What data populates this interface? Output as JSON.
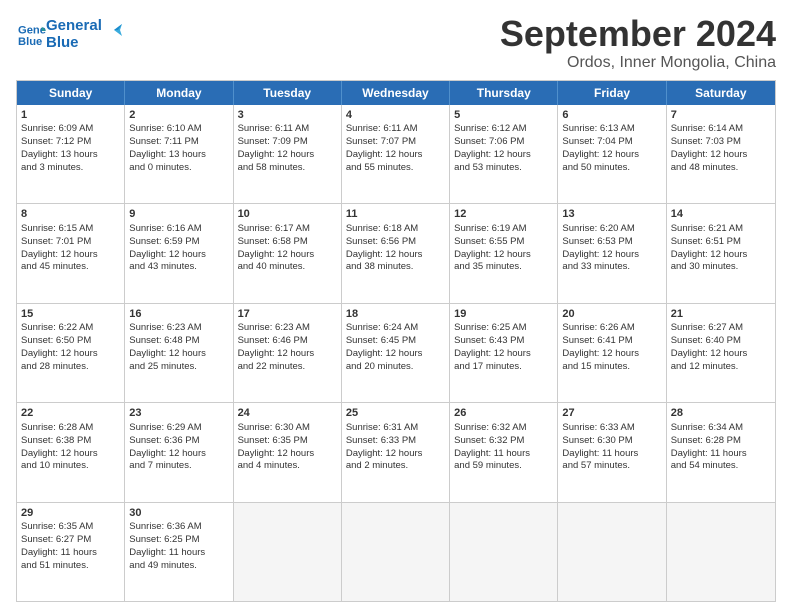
{
  "header": {
    "logo_line1": "General",
    "logo_line2": "Blue",
    "month": "September 2024",
    "location": "Ordos, Inner Mongolia, China"
  },
  "days_of_week": [
    "Sunday",
    "Monday",
    "Tuesday",
    "Wednesday",
    "Thursday",
    "Friday",
    "Saturday"
  ],
  "rows": [
    [
      {
        "day": "1",
        "lines": [
          "Sunrise: 6:09 AM",
          "Sunset: 7:12 PM",
          "Daylight: 13 hours",
          "and 3 minutes."
        ]
      },
      {
        "day": "2",
        "lines": [
          "Sunrise: 6:10 AM",
          "Sunset: 7:11 PM",
          "Daylight: 13 hours",
          "and 0 minutes."
        ]
      },
      {
        "day": "3",
        "lines": [
          "Sunrise: 6:11 AM",
          "Sunset: 7:09 PM",
          "Daylight: 12 hours",
          "and 58 minutes."
        ]
      },
      {
        "day": "4",
        "lines": [
          "Sunrise: 6:11 AM",
          "Sunset: 7:07 PM",
          "Daylight: 12 hours",
          "and 55 minutes."
        ]
      },
      {
        "day": "5",
        "lines": [
          "Sunrise: 6:12 AM",
          "Sunset: 7:06 PM",
          "Daylight: 12 hours",
          "and 53 minutes."
        ]
      },
      {
        "day": "6",
        "lines": [
          "Sunrise: 6:13 AM",
          "Sunset: 7:04 PM",
          "Daylight: 12 hours",
          "and 50 minutes."
        ]
      },
      {
        "day": "7",
        "lines": [
          "Sunrise: 6:14 AM",
          "Sunset: 7:03 PM",
          "Daylight: 12 hours",
          "and 48 minutes."
        ]
      }
    ],
    [
      {
        "day": "8",
        "lines": [
          "Sunrise: 6:15 AM",
          "Sunset: 7:01 PM",
          "Daylight: 12 hours",
          "and 45 minutes."
        ]
      },
      {
        "day": "9",
        "lines": [
          "Sunrise: 6:16 AM",
          "Sunset: 6:59 PM",
          "Daylight: 12 hours",
          "and 43 minutes."
        ]
      },
      {
        "day": "10",
        "lines": [
          "Sunrise: 6:17 AM",
          "Sunset: 6:58 PM",
          "Daylight: 12 hours",
          "and 40 minutes."
        ]
      },
      {
        "day": "11",
        "lines": [
          "Sunrise: 6:18 AM",
          "Sunset: 6:56 PM",
          "Daylight: 12 hours",
          "and 38 minutes."
        ]
      },
      {
        "day": "12",
        "lines": [
          "Sunrise: 6:19 AM",
          "Sunset: 6:55 PM",
          "Daylight: 12 hours",
          "and 35 minutes."
        ]
      },
      {
        "day": "13",
        "lines": [
          "Sunrise: 6:20 AM",
          "Sunset: 6:53 PM",
          "Daylight: 12 hours",
          "and 33 minutes."
        ]
      },
      {
        "day": "14",
        "lines": [
          "Sunrise: 6:21 AM",
          "Sunset: 6:51 PM",
          "Daylight: 12 hours",
          "and 30 minutes."
        ]
      }
    ],
    [
      {
        "day": "15",
        "lines": [
          "Sunrise: 6:22 AM",
          "Sunset: 6:50 PM",
          "Daylight: 12 hours",
          "and 28 minutes."
        ]
      },
      {
        "day": "16",
        "lines": [
          "Sunrise: 6:23 AM",
          "Sunset: 6:48 PM",
          "Daylight: 12 hours",
          "and 25 minutes."
        ]
      },
      {
        "day": "17",
        "lines": [
          "Sunrise: 6:23 AM",
          "Sunset: 6:46 PM",
          "Daylight: 12 hours",
          "and 22 minutes."
        ]
      },
      {
        "day": "18",
        "lines": [
          "Sunrise: 6:24 AM",
          "Sunset: 6:45 PM",
          "Daylight: 12 hours",
          "and 20 minutes."
        ]
      },
      {
        "day": "19",
        "lines": [
          "Sunrise: 6:25 AM",
          "Sunset: 6:43 PM",
          "Daylight: 12 hours",
          "and 17 minutes."
        ]
      },
      {
        "day": "20",
        "lines": [
          "Sunrise: 6:26 AM",
          "Sunset: 6:41 PM",
          "Daylight: 12 hours",
          "and 15 minutes."
        ]
      },
      {
        "day": "21",
        "lines": [
          "Sunrise: 6:27 AM",
          "Sunset: 6:40 PM",
          "Daylight: 12 hours",
          "and 12 minutes."
        ]
      }
    ],
    [
      {
        "day": "22",
        "lines": [
          "Sunrise: 6:28 AM",
          "Sunset: 6:38 PM",
          "Daylight: 12 hours",
          "and 10 minutes."
        ]
      },
      {
        "day": "23",
        "lines": [
          "Sunrise: 6:29 AM",
          "Sunset: 6:36 PM",
          "Daylight: 12 hours",
          "and 7 minutes."
        ]
      },
      {
        "day": "24",
        "lines": [
          "Sunrise: 6:30 AM",
          "Sunset: 6:35 PM",
          "Daylight: 12 hours",
          "and 4 minutes."
        ]
      },
      {
        "day": "25",
        "lines": [
          "Sunrise: 6:31 AM",
          "Sunset: 6:33 PM",
          "Daylight: 12 hours",
          "and 2 minutes."
        ]
      },
      {
        "day": "26",
        "lines": [
          "Sunrise: 6:32 AM",
          "Sunset: 6:32 PM",
          "Daylight: 11 hours",
          "and 59 minutes."
        ]
      },
      {
        "day": "27",
        "lines": [
          "Sunrise: 6:33 AM",
          "Sunset: 6:30 PM",
          "Daylight: 11 hours",
          "and 57 minutes."
        ]
      },
      {
        "day": "28",
        "lines": [
          "Sunrise: 6:34 AM",
          "Sunset: 6:28 PM",
          "Daylight: 11 hours",
          "and 54 minutes."
        ]
      }
    ],
    [
      {
        "day": "29",
        "lines": [
          "Sunrise: 6:35 AM",
          "Sunset: 6:27 PM",
          "Daylight: 11 hours",
          "and 51 minutes."
        ]
      },
      {
        "day": "30",
        "lines": [
          "Sunrise: 6:36 AM",
          "Sunset: 6:25 PM",
          "Daylight: 11 hours",
          "and 49 minutes."
        ]
      },
      {
        "day": "",
        "lines": []
      },
      {
        "day": "",
        "lines": []
      },
      {
        "day": "",
        "lines": []
      },
      {
        "day": "",
        "lines": []
      },
      {
        "day": "",
        "lines": []
      }
    ]
  ]
}
